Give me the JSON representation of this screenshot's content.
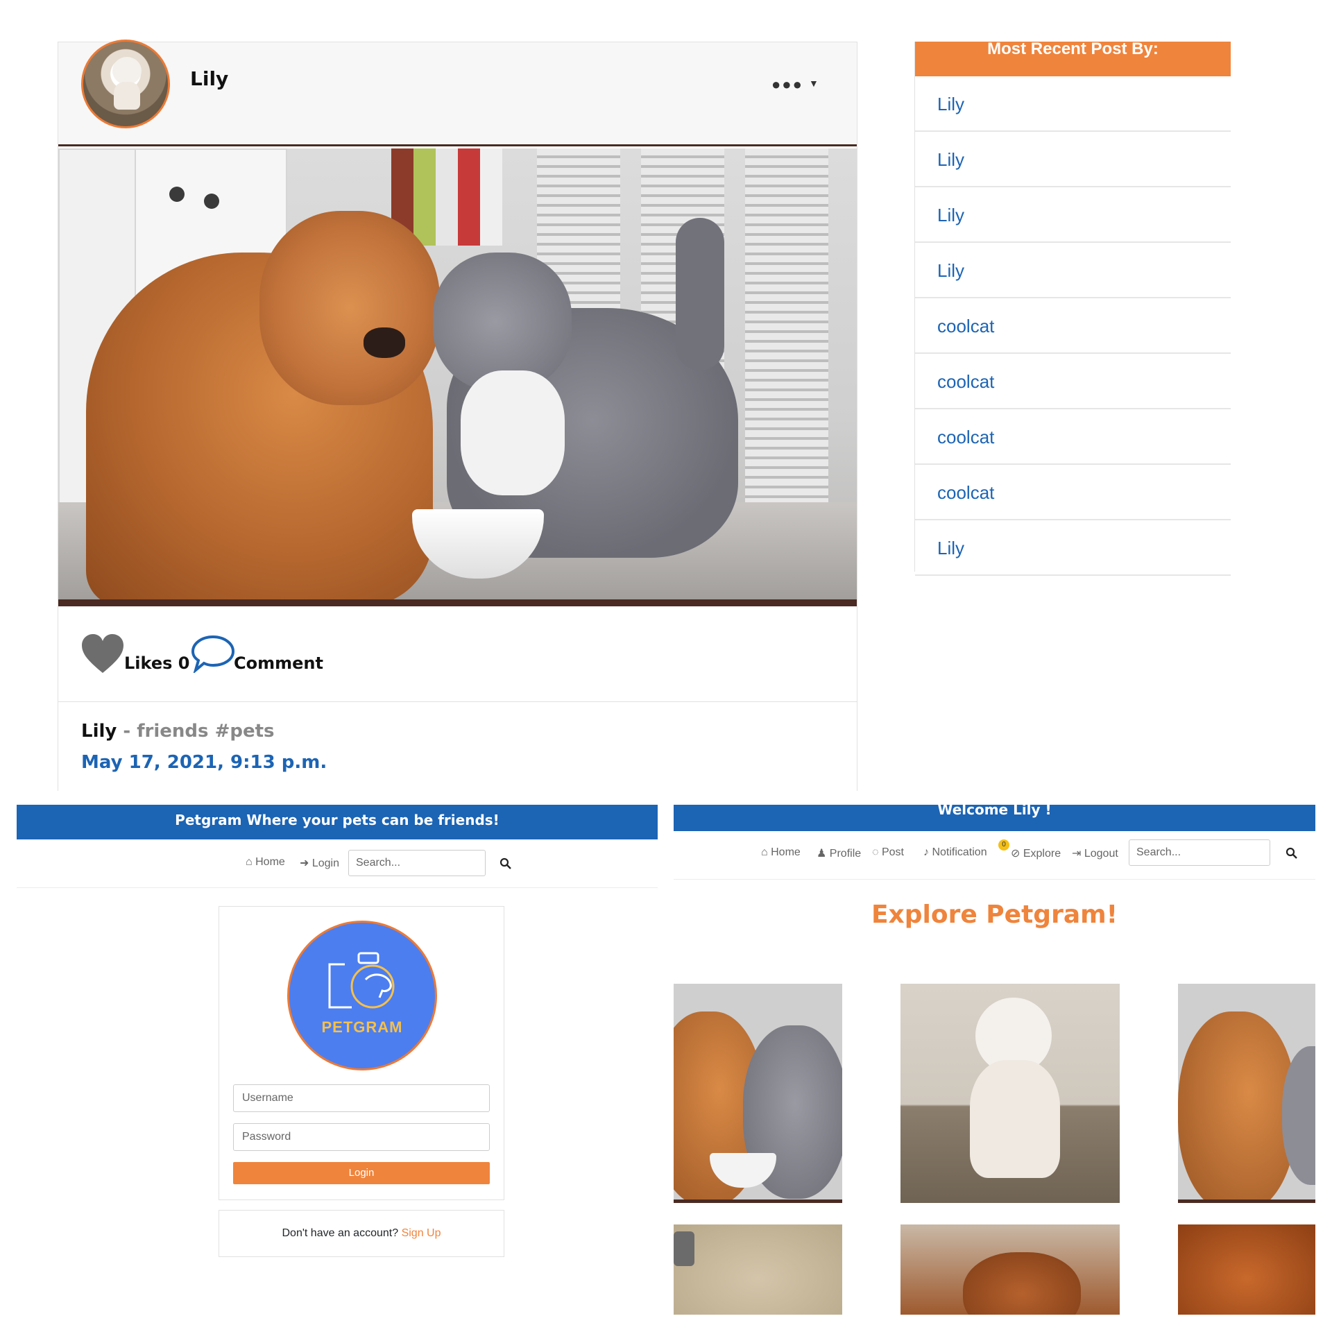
{
  "post": {
    "username": "Lily",
    "menu_icon": "more-icon",
    "likes_label": "Likes 0",
    "comment_label": "Comment",
    "caption_user": "Lily",
    "caption_text": " - friends #pets",
    "date": "May 17, 2021, 9:13 p.m."
  },
  "recent": {
    "header": "Most Recent Post By:",
    "items": [
      "Lily",
      "Lily",
      "Lily",
      "Lily",
      "coolcat",
      "coolcat",
      "coolcat",
      "coolcat",
      "Lily"
    ]
  },
  "login_page": {
    "banner": "Petgram Where your pets can be friends!",
    "nav": {
      "home": "Home",
      "login": "Login"
    },
    "search_placeholder": "Search...",
    "logo_text": "PETGRAM",
    "username_placeholder": "Username",
    "password_placeholder": "Password",
    "login_button": "Login",
    "signup_prompt": "Don't have an account? ",
    "signup_link": "Sign Up"
  },
  "explore_page": {
    "welcome": "Welcome Lily !",
    "nav": {
      "home": "Home",
      "profile": "Profile",
      "post": "Post",
      "notification": "Notification",
      "notification_count": "0",
      "explore": "Explore",
      "logout": "Logout"
    },
    "search_placeholder": "Search...",
    "title": "Explore Petgram!"
  },
  "colors": {
    "brand_blue": "#1c64b4",
    "accent_orange": "#ef843c",
    "notification_badge": "#f5c016"
  }
}
